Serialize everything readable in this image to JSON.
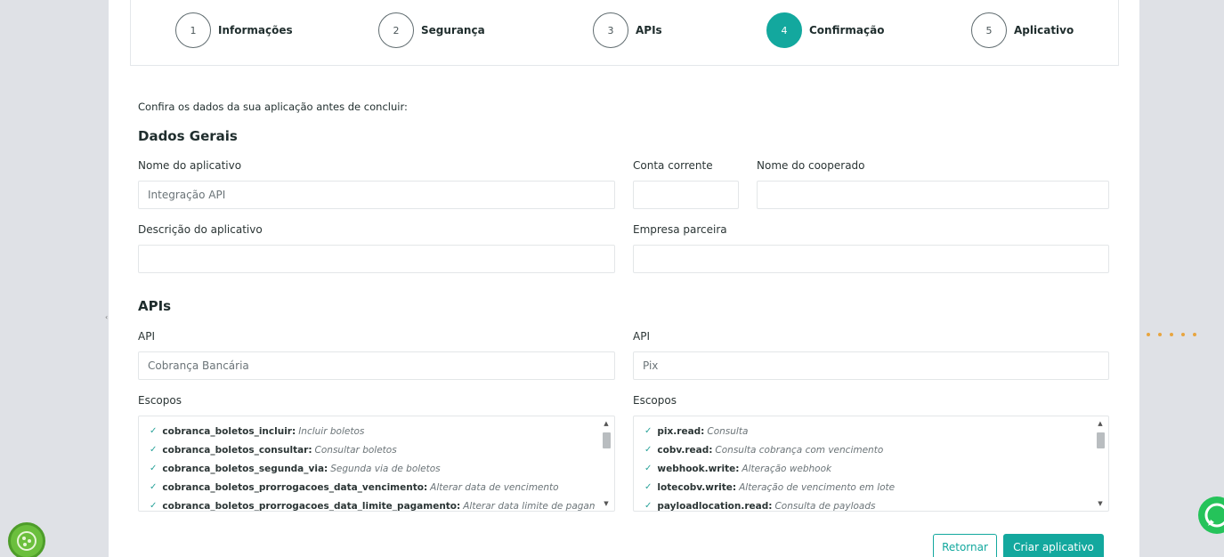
{
  "stepper": {
    "steps": [
      {
        "number": "1",
        "label": "Informações",
        "active": false
      },
      {
        "number": "2",
        "label": "Segurança",
        "active": false
      },
      {
        "number": "3",
        "label": "APIs",
        "active": false
      },
      {
        "number": "4",
        "label": "Confirmação",
        "active": true
      },
      {
        "number": "5",
        "label": "Aplicativo",
        "active": false
      }
    ],
    "active_color": "#13a89e"
  },
  "intro": "Confira os dados da sua aplicação antes de concluir:",
  "dados_gerais": {
    "title": "Dados Gerais",
    "nome_aplicativo": {
      "label": "Nome do aplicativo",
      "value": "Integração API"
    },
    "conta_corrente": {
      "label": "Conta corrente",
      "value": ""
    },
    "nome_cooperado": {
      "label": "Nome do cooperado",
      "value": ""
    },
    "descricao_aplicativo": {
      "label": "Descrição do aplicativo",
      "value": ""
    },
    "empresa_parceira": {
      "label": "Empresa parceira",
      "value": ""
    }
  },
  "apis": {
    "title": "APIs",
    "left": {
      "api_label": "API",
      "api_value": "Cobrança Bancária",
      "scopes_label": "Escopos",
      "scopes": [
        {
          "key": "cobranca_boletos_incluir:",
          "desc": "Incluir boletos"
        },
        {
          "key": "cobranca_boletos_consultar:",
          "desc": "Consultar boletos"
        },
        {
          "key": "cobranca_boletos_segunda_via:",
          "desc": "Segunda via de boletos"
        },
        {
          "key": "cobranca_boletos_prorrogacoes_data_vencimento:",
          "desc": "Alterar data de vencimento"
        },
        {
          "key": "cobranca_boletos_prorrogacoes_data_limite_pagamento:",
          "desc": "Alterar data limite de pagamento"
        }
      ]
    },
    "right": {
      "api_label": "API",
      "api_value": "Pix",
      "scopes_label": "Escopos",
      "scopes": [
        {
          "key": "pix.read:",
          "desc": "Consulta"
        },
        {
          "key": "cobv.read:",
          "desc": "Consulta cobrança com vencimento"
        },
        {
          "key": "webhook.write:",
          "desc": "Alteração webhook"
        },
        {
          "key": "lotecobv.write:",
          "desc": "Alteração de vencimento em lote"
        },
        {
          "key": "payloadlocation.read:",
          "desc": "Consulta de payloads"
        }
      ]
    }
  },
  "actions": {
    "back_label": "Retornar",
    "create_label": "Criar aplicativo"
  },
  "icons": {
    "check": "check-icon",
    "scroll_up": "scroll-up-icon",
    "scroll_down": "scroll-down-icon",
    "whatsapp": "whatsapp-icon"
  }
}
